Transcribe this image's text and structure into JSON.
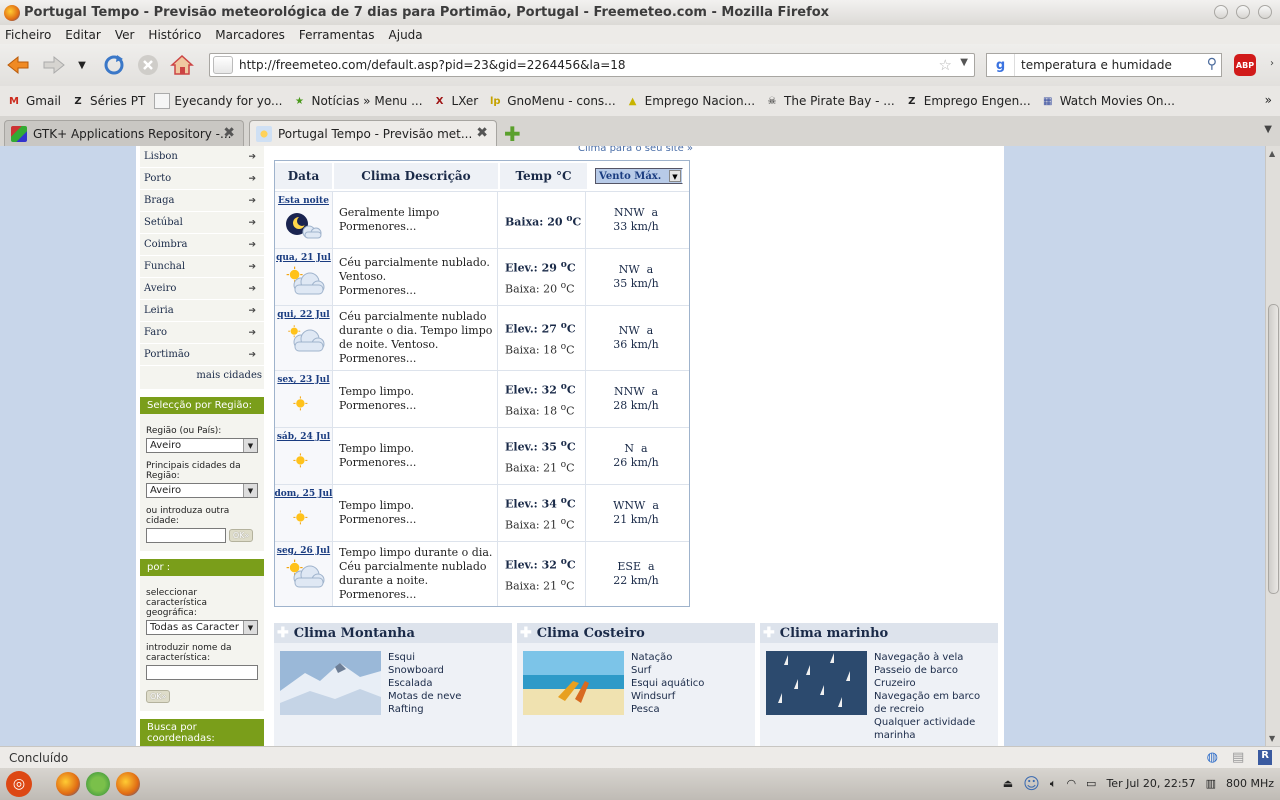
{
  "window": {
    "title": "Portugal Tempo - Previsão meteorológica de 7 dias para Portimão, Portugal - Freemeteo.com - Mozilla Firefox"
  },
  "menu": [
    "Ficheiro",
    "Editar",
    "Ver",
    "Histórico",
    "Marcadores",
    "Ferramentas",
    "Ajuda"
  ],
  "url": "http://freemeteo.com/default.asp?pid=23&gid=2264456&la=18",
  "search": {
    "value": "temperatura e humidade"
  },
  "abp_label": "ABP",
  "bookmarks": [
    {
      "label": "Gmail",
      "icon": "gmail-icon",
      "glyph": "M",
      "color": "#cc2b1e"
    },
    {
      "label": "Séries PT",
      "icon": "z-icon",
      "glyph": "Z",
      "color": "#222"
    },
    {
      "label": "Eyecandy for yo...",
      "icon": "bookmark-icon",
      "glyph": "",
      "color": "#888"
    },
    {
      "label": "Notícias » Menu ...",
      "icon": "star-icon",
      "glyph": "★",
      "color": "#4b9a1c"
    },
    {
      "label": "LXer",
      "icon": "x-icon",
      "glyph": "X",
      "color": "#a01818"
    },
    {
      "label": "GnoMenu - cons...",
      "icon": "lp-icon",
      "glyph": "lp",
      "color": "#c5a200"
    },
    {
      "label": "Emprego Nacion...",
      "icon": "emprego-icon",
      "glyph": "▲",
      "color": "#c8b400"
    },
    {
      "label": "The Pirate Bay - ...",
      "icon": "pirate-icon",
      "glyph": "☠",
      "color": "#222"
    },
    {
      "label": "Emprego Engen...",
      "icon": "z-icon",
      "glyph": "Z",
      "color": "#222"
    },
    {
      "label": "Watch Movies On...",
      "icon": "film-icon",
      "glyph": "▦",
      "color": "#3a4fa0"
    }
  ],
  "tabs": [
    {
      "label": "GTK+ Applications Repository -...",
      "active": false
    },
    {
      "label": "Portugal Tempo - Previsão met...",
      "active": true
    }
  ],
  "sidebar": {
    "cities": [
      "Lisbon",
      "Porto",
      "Braga",
      "Setúbal",
      "Coimbra",
      "Funchal",
      "Aveiro",
      "Leiria",
      "Faro",
      "Portimão"
    ],
    "more_cities": "mais cidades",
    "region_panel": {
      "title": "Selecção por Região:",
      "region_label": "Região (ou País):",
      "region_value": "Aveiro",
      "cities_label": "Principais cidades da Região:",
      "cities_value": "Aveiro",
      "other_city_label": "ou introduza outra cidade:",
      "ok_label": "OK»"
    },
    "feature_panel": {
      "title": "por :",
      "select_label": "seleccionar característica geográfica:",
      "select_value": "Todas as Caracter",
      "name_label": "introduzir nome da característica:",
      "ok_label": "OK»"
    },
    "coords_panel": {
      "title": "Busca por coordenadas:"
    }
  },
  "top_link": "Clima para o seu site »",
  "forecast": {
    "headers": {
      "date": "Data",
      "desc": "Clima Descrição",
      "temp": "Temp °C",
      "wind": "Vento Máx."
    },
    "rows": [
      {
        "day": "Esta noite",
        "icon": "night-partly-cloudy-icon",
        "desc": [
          "Geralmente limpo",
          "Pormenores..."
        ],
        "hi_label": "",
        "hi": "",
        "lo_label": "Baixa:",
        "lo": "20",
        "lo_bold": true,
        "wind_dir": "NNW",
        "wind_speed": "33 km/h"
      },
      {
        "day": "qua, 21 Jul",
        "icon": "sun-cloud-icon",
        "desc": [
          "Céu parcialmente nublado.",
          "Ventoso.",
          "Pormenores..."
        ],
        "hi_label": "Elev.:",
        "hi": "29",
        "lo_label": "Baixa:",
        "lo": "20",
        "lo_bold": false,
        "wind_dir": "NW",
        "wind_speed": "35 km/h"
      },
      {
        "day": "qui, 22 Jul",
        "icon": "cloudy-icon",
        "desc": [
          "Céu parcialmente nublado",
          "durante o dia. Tempo limpo",
          "de noite. Ventoso.",
          "Pormenores..."
        ],
        "hi_label": "Elev.:",
        "hi": "27",
        "lo_label": "Baixa:",
        "lo": "18",
        "lo_bold": false,
        "wind_dir": "NW",
        "wind_speed": "36 km/h"
      },
      {
        "day": "sex, 23 Jul",
        "icon": "sun-icon",
        "desc": [
          "Tempo limpo.",
          "Pormenores..."
        ],
        "hi_label": "Elev.:",
        "hi": "32",
        "lo_label": "Baixa:",
        "lo": "18",
        "lo_bold": false,
        "wind_dir": "NNW",
        "wind_speed": "28 km/h"
      },
      {
        "day": "sáb, 24 Jul",
        "icon": "sun-icon",
        "desc": [
          "Tempo limpo.",
          "Pormenores..."
        ],
        "hi_label": "Elev.:",
        "hi": "35",
        "lo_label": "Baixa:",
        "lo": "21",
        "lo_bold": false,
        "wind_dir": "N",
        "wind_speed": "26 km/h"
      },
      {
        "day": "dom, 25 Jul",
        "icon": "sun-icon",
        "desc": [
          "Tempo limpo.",
          "Pormenores..."
        ],
        "hi_label": "Elev.:",
        "hi": "34",
        "lo_label": "Baixa:",
        "lo": "21",
        "lo_bold": false,
        "wind_dir": "WNW",
        "wind_speed": "21 km/h"
      },
      {
        "day": "seg, 26 Jul",
        "icon": "sun-cloud-icon",
        "desc": [
          "Tempo limpo durante o dia.",
          "Céu parcialmente nublado",
          "durante a noite.",
          "Pormenores..."
        ],
        "hi_label": "Elev.:",
        "hi": "32",
        "lo_label": "Baixa:",
        "lo": "21",
        "lo_bold": false,
        "wind_dir": "ESE",
        "wind_speed": "22 km/h"
      }
    ]
  },
  "boxes": [
    {
      "title": "Clima Montanha",
      "image": "mountain-photo",
      "items": [
        "Esqui",
        "Snowboard",
        "Escalada",
        "Motas de neve",
        "Rafting"
      ]
    },
    {
      "title": "Clima Costeiro",
      "image": "beach-photo",
      "items": [
        "Natação",
        "Surf",
        "Esqui aquático",
        "Windsurf",
        "Pesca"
      ]
    },
    {
      "title": "Clima marinho",
      "image": "sailboats-photo",
      "items": [
        "Navegação à vela",
        "Passeio de barco",
        "Cruzeiro",
        "Navegação em barco",
        "de recreio",
        "Qualquer actividade",
        "marinha"
      ]
    }
  ],
  "status": "Concluído",
  "clock": "Ter Jul 20, 22:57",
  "cpu": "800 MHz",
  "colors": {
    "accent_green": "#7a9e1a",
    "page_bg": "#c8d6ea",
    "link_blue": "#1a3c80"
  }
}
